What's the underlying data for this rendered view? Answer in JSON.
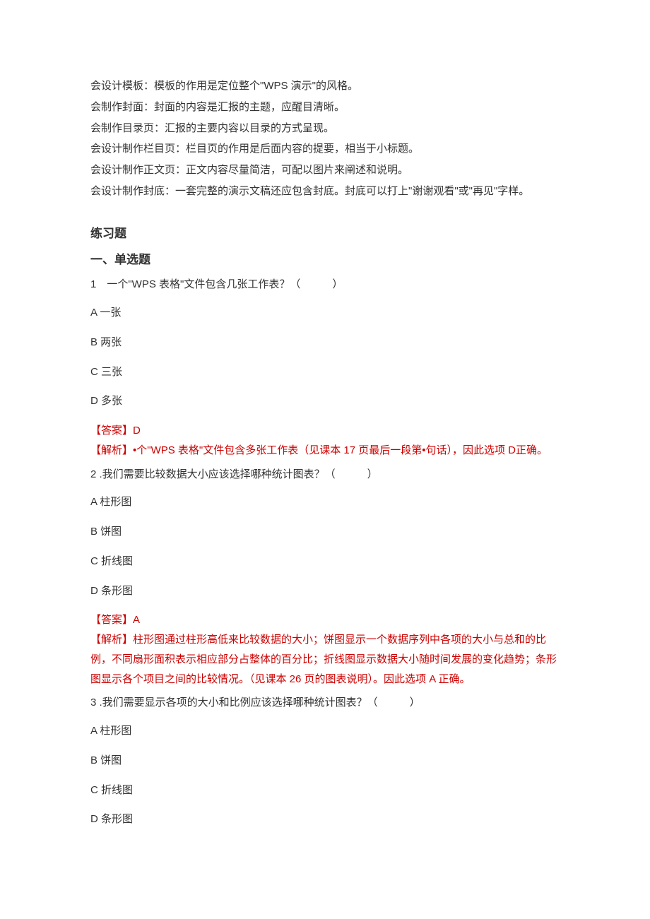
{
  "intro": [
    "会设计模板：模板的作用是定位整个\"WPS 演示\"的风格。",
    "会制作封面：封面的内容是汇报的主题，应醒目清晰。",
    "会制作目录页：汇报的主要内容以目录的方式呈现。",
    "会设计制作栏目页：栏目页的作用是后面内容的提要，相当于小标题。",
    "会设计制作正文页：正文内容尽量简洁，可配以图片来阐述和说明。",
    "会设计制作封底：一套完整的演示文稿还应包含封底。封底可以打上\"谢谢观看\"或\"再见\"字样。"
  ],
  "headings": {
    "exercises": "练习题",
    "single_choice": "一、单选题"
  },
  "questions": [
    {
      "stem": "1　一个\"WPS 表格\"文件包含几张工作表？（　　　）",
      "options": [
        "A 一张",
        "B 两张",
        "C 三张",
        "D 多张"
      ],
      "answer": "【答案】D",
      "explanation": "【解析】•个\"WPS 表格\"文件包含多张工作表（见课本 17 页最后一段第•句话），因此选项 D正确。"
    },
    {
      "stem": "2  .我们需要比较数据大小应该选择哪种统计图表？（　　　）",
      "options": [
        "A 柱形图",
        "B 饼图",
        "C 折线图",
        "D 条形图"
      ],
      "answer": "【答案】A",
      "explanation": "【解析】柱形图通过柱形高低来比较数据的大小；饼图显示一个数据序列中各项的大小与总和的比例，不同扇形面积表示相应部分占整体的百分比；折线图显示数据大小随时间发展的变化趋势；条形图显示各个项目之间的比较情况。（见课本 26 页的图表说明）。因此选项 A 正确。"
    },
    {
      "stem": "3  .我们需要显示各项的大小和比例应该选择哪种统计图表？（　　　）",
      "options": [
        "A 柱形图",
        "B 饼图",
        "C 折线图",
        "D 条形图"
      ],
      "answer": "",
      "explanation": ""
    }
  ]
}
